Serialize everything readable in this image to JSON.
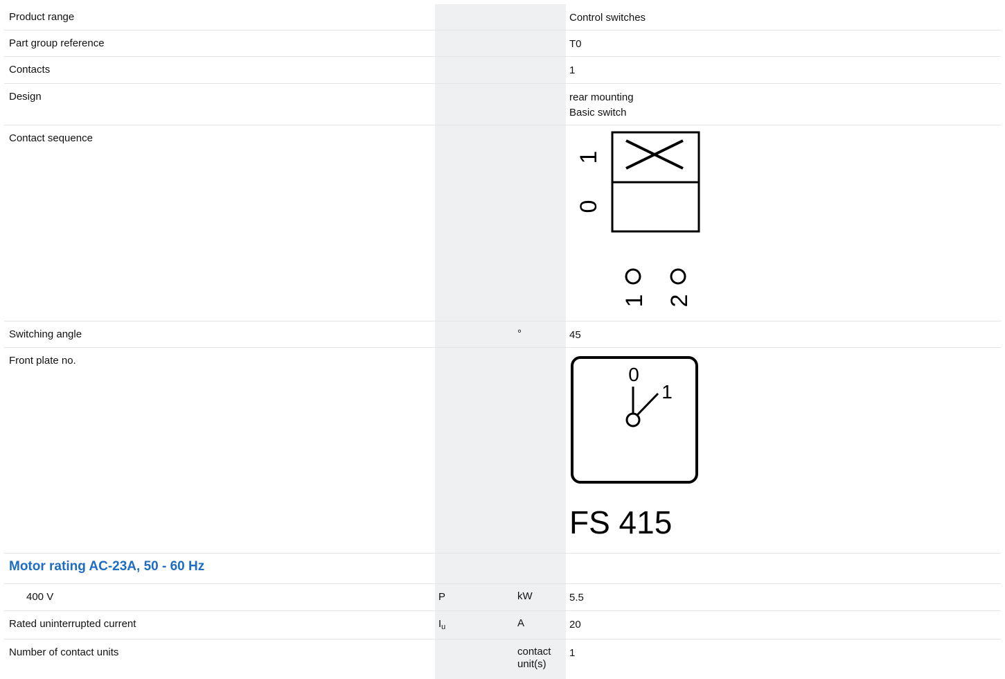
{
  "rows": {
    "product_range": {
      "label": "Product range",
      "value": "Control switches"
    },
    "part_group": {
      "label": "Part group reference",
      "value": "T0"
    },
    "contacts": {
      "label": "Contacts",
      "value": "1"
    },
    "design": {
      "label": "Design",
      "values": [
        "rear mounting",
        "Basic switch"
      ]
    },
    "contact_sequence": {
      "label": "Contact sequence",
      "positions": [
        "0",
        "1"
      ],
      "terminals": [
        "1",
        "2"
      ]
    },
    "switching_angle": {
      "label": "Switching angle",
      "unit": "°",
      "value": "45"
    },
    "front_plate": {
      "label": "Front plate no.",
      "positions": [
        "0",
        "1"
      ],
      "code": "FS 415"
    },
    "motor_section": {
      "title": "Motor rating AC-23A, 50 - 60 Hz"
    },
    "motor_400v": {
      "label": "400 V",
      "symbol": "P",
      "unit": "kW",
      "value": "5.5"
    },
    "rated_current": {
      "label": "Rated uninterrupted current",
      "symbol": "I",
      "symbol_sub": "u",
      "unit": "A",
      "value": "20"
    },
    "contact_units": {
      "label": "Number of contact units",
      "unit": "contact unit(s)",
      "value": "1"
    }
  }
}
